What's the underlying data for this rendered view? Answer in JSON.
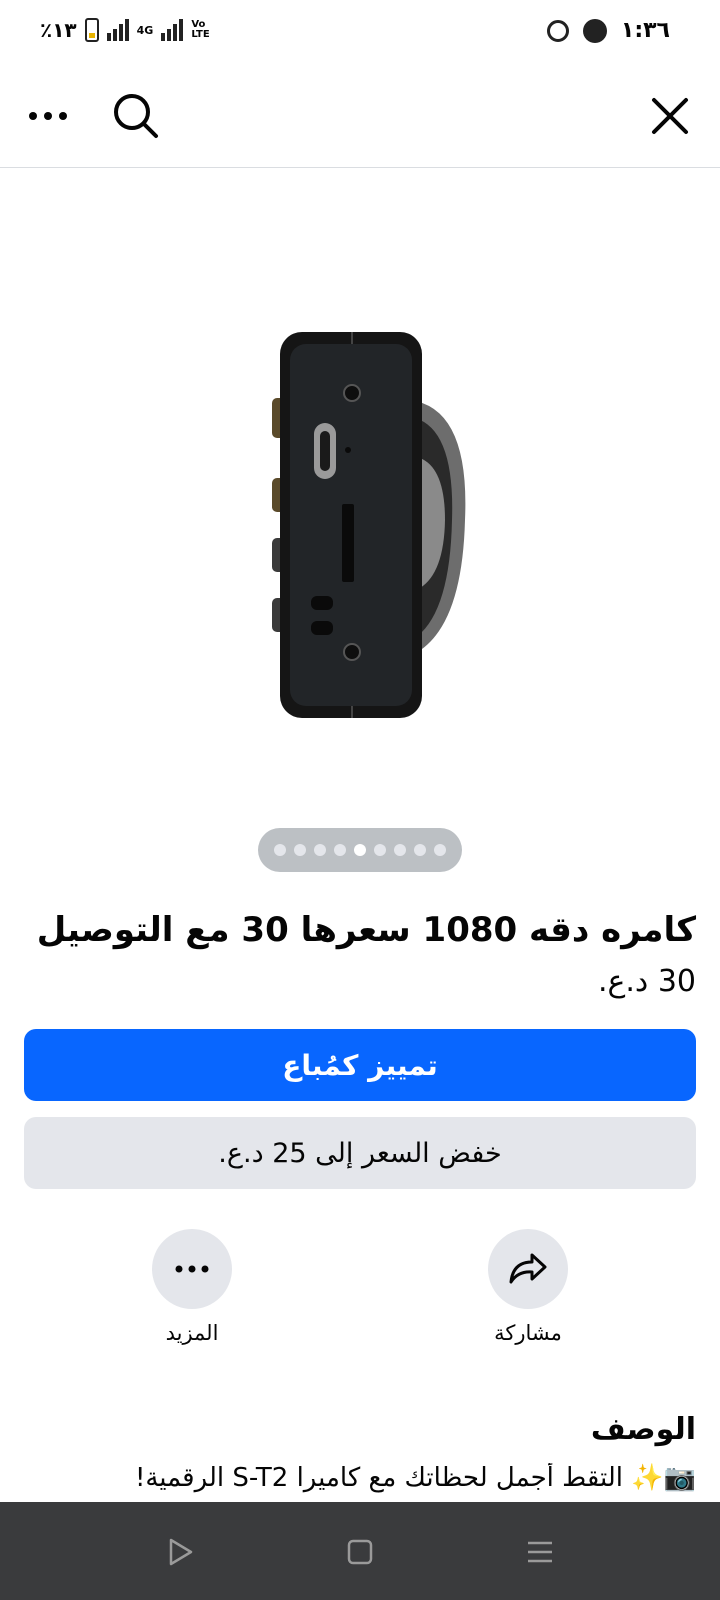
{
  "status_bar": {
    "battery_percent": "٪١٣",
    "network": "4G",
    "volte": "Vo LTE",
    "time": "١:٣٦"
  },
  "nav": {
    "icons": [
      "more-icon",
      "search-icon",
      "close-icon"
    ]
  },
  "gallery": {
    "photo_count": 9,
    "active_index": 4
  },
  "listing": {
    "title": "كامره دقه 1080  سعرها  30 مع التوصيل",
    "price": "30 د.ع."
  },
  "buttons": {
    "boost_label": "تمييز كمُباع",
    "lower_price_label": "خفض السعر إلى 25 د.ع."
  },
  "actions": {
    "share_label": "مشاركة",
    "more_label": "المزيد"
  },
  "description": {
    "heading": "الوصف",
    "text": "📷✨ التقط أجمل لحظاتك مع كاميرا S-T2 الرقمية!"
  },
  "colors": {
    "primary": "#0866ff",
    "secondary_bg": "#e4e6eb",
    "system_nav": "#3a3b3d"
  }
}
